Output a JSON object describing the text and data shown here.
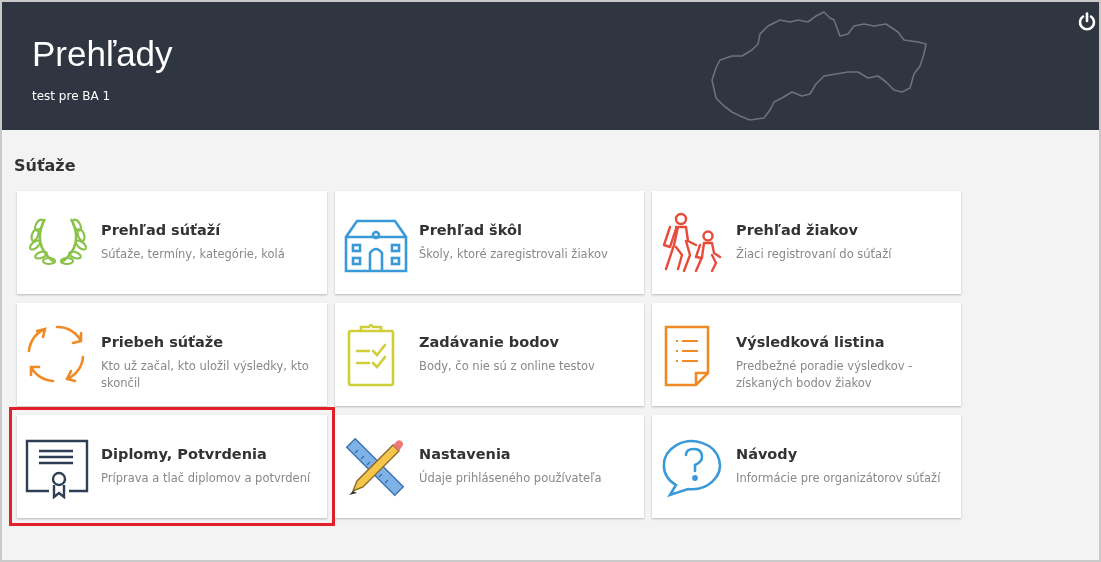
{
  "header": {
    "title": "Prehľady",
    "subtitle": "test pre BA 1"
  },
  "section": {
    "title": "Súťaže"
  },
  "tiles": [
    {
      "kind": "laurel",
      "title": "Prehľad súťaží",
      "description": "Súťaže, termíny, kategórie, kolá",
      "highlighted": false
    },
    {
      "kind": "school",
      "title": "Prehľad škôl",
      "description": "Školy, ktoré zaregistrovali žiakov",
      "highlighted": false
    },
    {
      "kind": "hikers",
      "title": "Prehľad žiakov",
      "description": "Žiaci registrovaní do súťaží",
      "highlighted": false
    },
    {
      "kind": "cycle",
      "title": "Priebeh súťaže",
      "description": "Kto už začal, kto uložil výsledky, kto skončil",
      "highlighted": false
    },
    {
      "kind": "clipboard",
      "title": "Zadávanie bodov",
      "description": "Body, čo nie sú z online testov",
      "highlighted": false
    },
    {
      "kind": "document",
      "title": "Výsledková listina",
      "description": "Predbežné poradie výsledkov - získaných bodov žiakov",
      "highlighted": false
    },
    {
      "kind": "certificate",
      "title": "Diplomy, Potvrdenia",
      "description": "Príprava a tlač diplomov a potvrdení",
      "highlighted": true
    },
    {
      "kind": "tools",
      "title": "Nastavenia",
      "description": "Údaje prihláseného používateľa",
      "highlighted": false
    },
    {
      "kind": "question",
      "title": "Návody",
      "description": "Informácie pre organizátorov súťaží",
      "highlighted": false
    }
  ]
}
